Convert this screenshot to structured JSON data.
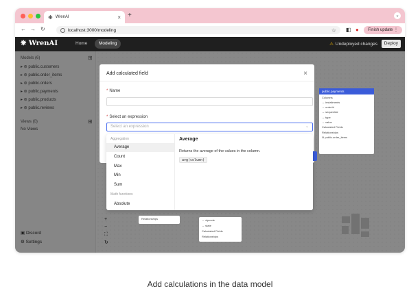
{
  "browser": {
    "tab_title": "WrenAI",
    "url": "localhost:3000/modeling",
    "finish_update": "Finish update",
    "dot_colors": [
      "#ff5f57",
      "#febc2e",
      "#28c840"
    ]
  },
  "app": {
    "brand": "WrenAI",
    "nav_home": "Home",
    "nav_modeling": "Modeling",
    "undeployed": "Undeployed changes",
    "deploy": "Deploy"
  },
  "sidebar": {
    "models_title": "Models (6)",
    "models": [
      "public.customers",
      "public.order_items",
      "public.orders",
      "public.payments",
      "public.products",
      "public.reviews"
    ],
    "views_title": "Views (0)",
    "views_empty": "No Views",
    "discord": "Discord",
    "settings": "Settings"
  },
  "canvas_card": {
    "header": "public.payments",
    "rows": [
      "Columns",
      "installments",
      "orderId",
      "sequential",
      "type",
      "value",
      "Calculated Fields",
      "Relationships",
      "public.order_items"
    ]
  },
  "canvas_minis": {
    "rows_a": [
      "Relationships"
    ],
    "rows_b": [
      "zipcode",
      "state",
      "Calculated Fields",
      "Relationships"
    ]
  },
  "modal": {
    "title": "Add calculated field",
    "name_label": "Name",
    "expr_label": "Select an expression",
    "expr_placeholder": "Select an expression"
  },
  "dropdown": {
    "group_aggregation": "Aggregation",
    "items": [
      "Average",
      "Count",
      "Max",
      "Min",
      "Sum"
    ],
    "group_math": "Math functions",
    "math_items": [
      "Absolute"
    ],
    "selected": "Average",
    "detail_title": "Average",
    "detail_desc": "Returns the average of the values in the column.",
    "detail_code": "avg(column)"
  },
  "caption": "Add calculations in the data model"
}
